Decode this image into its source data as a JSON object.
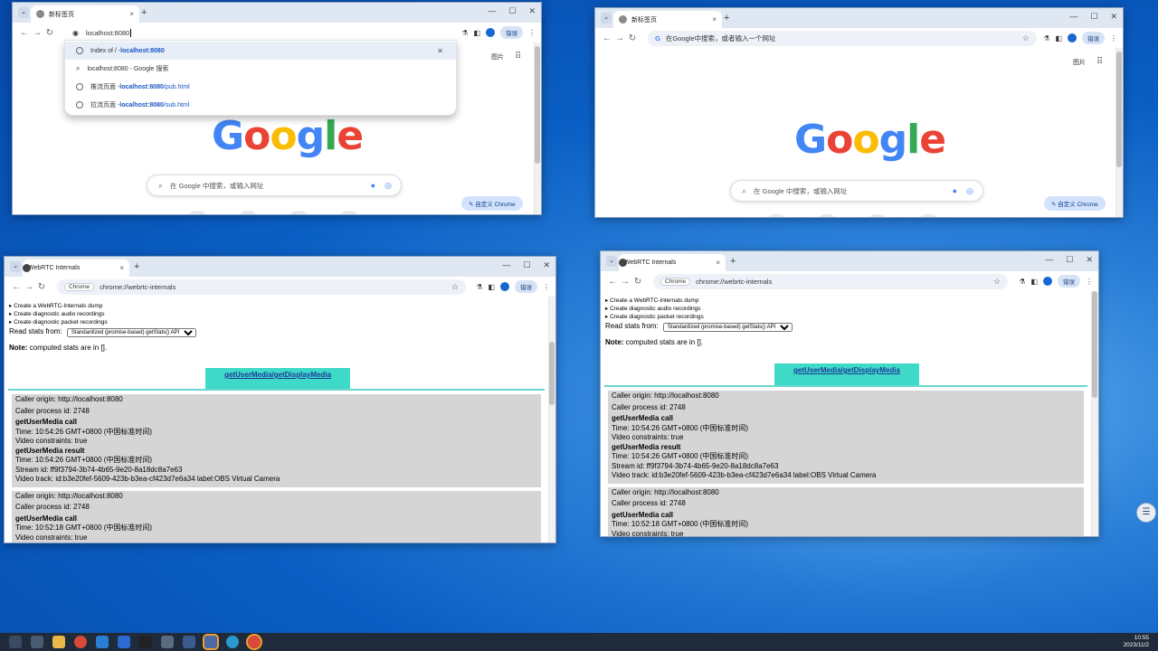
{
  "win1": {
    "tab_title": "新标签页",
    "omnibox_text": "localhost:8080",
    "suggestions": [
      {
        "prefix": "Index of / - ",
        "url": "localhost:8080",
        "path": ""
      },
      {
        "prefix": "localhost:8080 - Google 搜索",
        "url": "",
        "path": ""
      },
      {
        "prefix": "推流页面 - ",
        "url": "localhost:8080",
        "path": "/pub.html"
      },
      {
        "prefix": "拉流页面 - ",
        "url": "localhost:8080",
        "path": "/sub.html"
      }
    ],
    "images_label": "图片",
    "search_placeholder": "在 Google 中搜索，或输入网址",
    "customize_label": "自定义 Chrome",
    "error_pill": "错误"
  },
  "win2": {
    "tab_title": "新标签页",
    "omnibox_placeholder": "在Google中搜索，或者输入一个网址",
    "images_label": "图片",
    "search_placeholder": "在 Google 中搜索，或输入网址",
    "customize_label": "自定义 Chrome",
    "error_pill": "错误"
  },
  "google_letters": [
    "G",
    "o",
    "o",
    "g",
    "l",
    "e"
  ],
  "rtc_common": {
    "tab_title": "WebRTC Internals",
    "chip": "Chrome",
    "url": "chrome://webrtc-internals",
    "error_pill": "错误",
    "details": [
      "▸ Create a WebRTC-Internals dump",
      "▸ Create diagnostic audio recordings",
      "▸ Create diagnostic packet recordings"
    ],
    "read_stats_label": "Read stats from:",
    "read_stats_value": "Standardized (promise-based) getStats() API",
    "note_bold": "Note:",
    "note_text": " computed stats are in [].",
    "gum_tab": "getUserMedia/getDisplayMedia",
    "entry1": {
      "origin": "Caller origin: http://localhost:8080",
      "pid": "Caller process id: 2748",
      "call_h": "getUserMedia call",
      "call_time": "Time: 10:54:26 GMT+0800 (中国标准时间)",
      "constraints": "Video constraints: true",
      "result_h": "getUserMedia result",
      "result_time": "Time: 10:54:26 GMT+0800 (中国标准时间)",
      "stream": "Stream id: ff9f3794-3b74-4b65-9e20-8a18dc8a7e63",
      "track": "Video track: id:b3e20fef-5609-423b-b3ea-cf423d7e6a34 label:OBS Virtual Camera"
    },
    "entry2": {
      "origin": "Caller origin: http://localhost:8080",
      "pid": "Caller process id: 2748",
      "call_h": "getUserMedia call",
      "call_time": "Time: 10:52:18 GMT+0800 (中国标准时间)",
      "constraints": "Video constraints: true"
    }
  },
  "taskbar": {
    "time": "10:55",
    "date": "2023/11/2"
  }
}
